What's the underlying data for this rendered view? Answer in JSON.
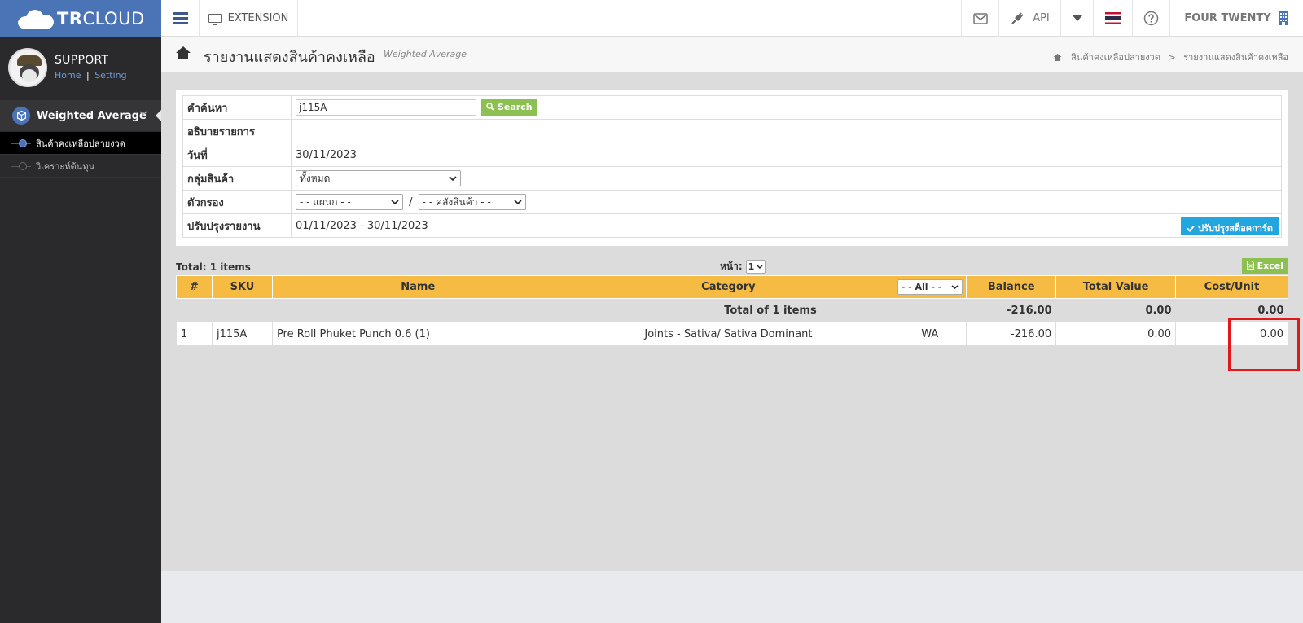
{
  "brand": {
    "logo_text_bold": "TR",
    "logo_text_rest": "CLOUD"
  },
  "topbar": {
    "extension_label": "EXTENSION",
    "api_label": "API",
    "company_name": "FOUR TWENTY"
  },
  "profile": {
    "name": "SUPPORT",
    "home_link": "Home",
    "separator": "|",
    "setting_link": "Setting"
  },
  "sidebar": {
    "menu_title": "Weighted Average",
    "items": [
      {
        "label": "สินค้าคงเหลือปลายงวด"
      },
      {
        "label": "วิเคราะห์ต้นทุน"
      }
    ]
  },
  "page_header": {
    "title": "รายงานแสดงสินค้าคงเหลือ",
    "subtitle": "Weighted Average",
    "breadcrumb": [
      "สินค้าคงเหลือปลายงวด",
      "รายงานแสดงสินค้าคงเหลือ"
    ],
    "breadcrumb_sep": ">"
  },
  "filters": {
    "search_label": "คำค้นหา",
    "search_value": "j115A",
    "search_button": "Search",
    "description_label": "อธิบายรายการ",
    "date_label": "วันที่",
    "date_value": "30/11/2023",
    "group_label": "กลุ่มสินค้า",
    "group_value": "ทั้งหมด",
    "filter_label": "ตัวกรอง",
    "department_value": "- - แผนก - -",
    "filter_sep": "/",
    "warehouse_value": "- - คลังสินค้า - -",
    "update_label": "ปรับปรุงรายงาน",
    "update_range": "01/11/2023 - 30/11/2023",
    "update_button": "ปรับปรุงสต็อคการ์ด"
  },
  "list": {
    "total_text": "Total: 1 items",
    "page_label": "หน้า:",
    "page_value": "1",
    "excel_button": "Excel"
  },
  "table": {
    "headers": {
      "num": "#",
      "sku": "SKU",
      "name": "Name",
      "category": "Category",
      "method_filter": "- - All - -",
      "balance": "Balance",
      "total_value": "Total Value",
      "cost_unit": "Cost/Unit"
    },
    "total_row": {
      "label": "Total of 1 items",
      "balance": "-216.00",
      "total_value": "0.00",
      "cost_unit": "0.00"
    },
    "rows": [
      {
        "num": "1",
        "sku": "j115A",
        "name": "Pre Roll Phuket Punch 0.6 (1)",
        "category": "Joints - Sativa/ Sativa Dominant",
        "method": "WA",
        "balance": "-216.00",
        "total_value": "0.00",
        "cost_unit": "0.00"
      }
    ]
  },
  "colors": {
    "brand_blue": "#4b74b7",
    "table_header": "#f6bb42",
    "green_button": "#8cc152",
    "blue_button": "#23a5e0",
    "highlight": "#e0191a"
  }
}
